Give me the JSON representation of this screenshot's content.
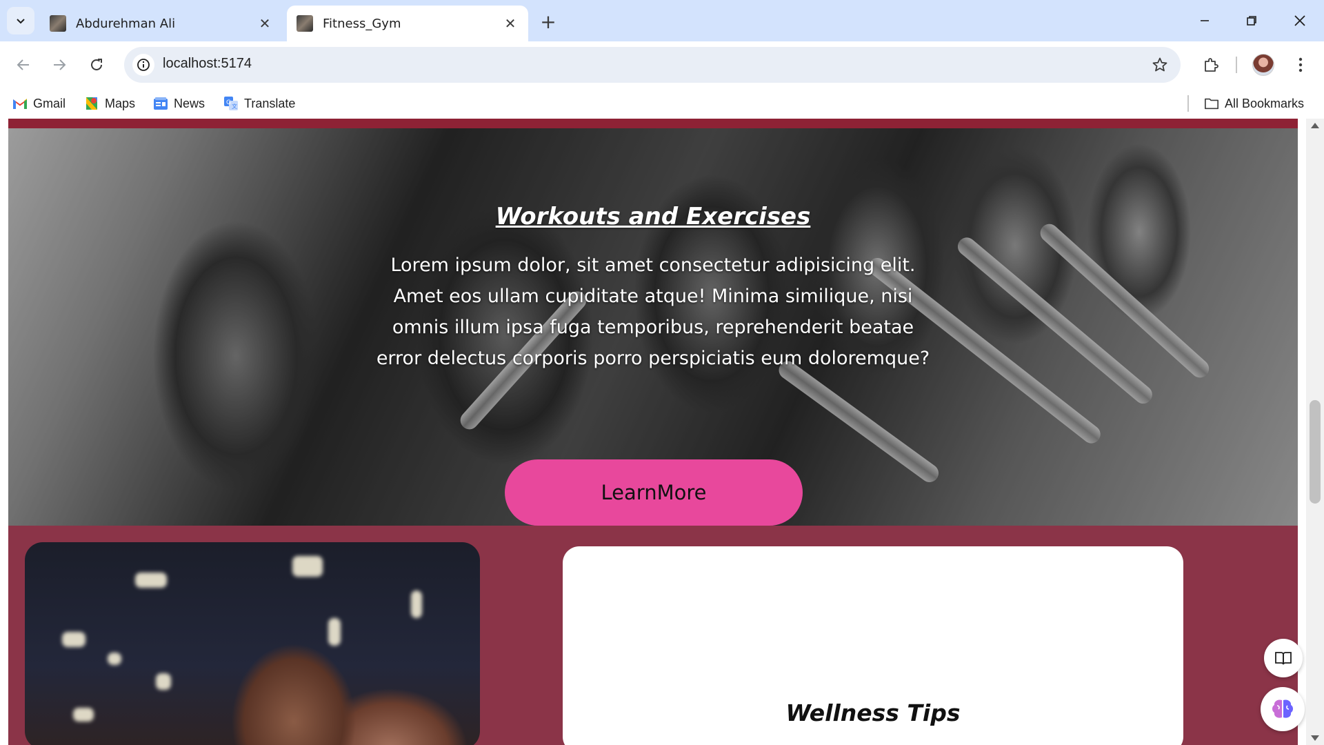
{
  "browser": {
    "tabs": [
      {
        "title": "Abdurehman Ali",
        "active": false
      },
      {
        "title": "Fitness_Gym",
        "active": true
      }
    ],
    "address": "localhost:5174",
    "bookmarks": [
      {
        "label": "Gmail",
        "icon": "gmail-icon"
      },
      {
        "label": "Maps",
        "icon": "maps-icon"
      },
      {
        "label": "News",
        "icon": "news-icon"
      },
      {
        "label": "Translate",
        "icon": "translate-icon"
      }
    ],
    "all_bookmarks": "All Bookmarks"
  },
  "page": {
    "hero": {
      "title": "Workouts and Exercises",
      "text": "Lorem ipsum dolor, sit amet consectetur adipisicing elit. Amet eos ullam cupiditate atque! Minima similique, nisi omnis illum ipsa fuga temporibus, reprehenderit beatae error delectus corporis porro perspiciatis eum doloremque?",
      "button": "LearnMore"
    },
    "wellness": {
      "title": "Wellness Tips"
    }
  },
  "colors": {
    "accent_pink": "#e8489c",
    "maroon": "#8b3448",
    "tabstrip": "#d3e3fd"
  }
}
